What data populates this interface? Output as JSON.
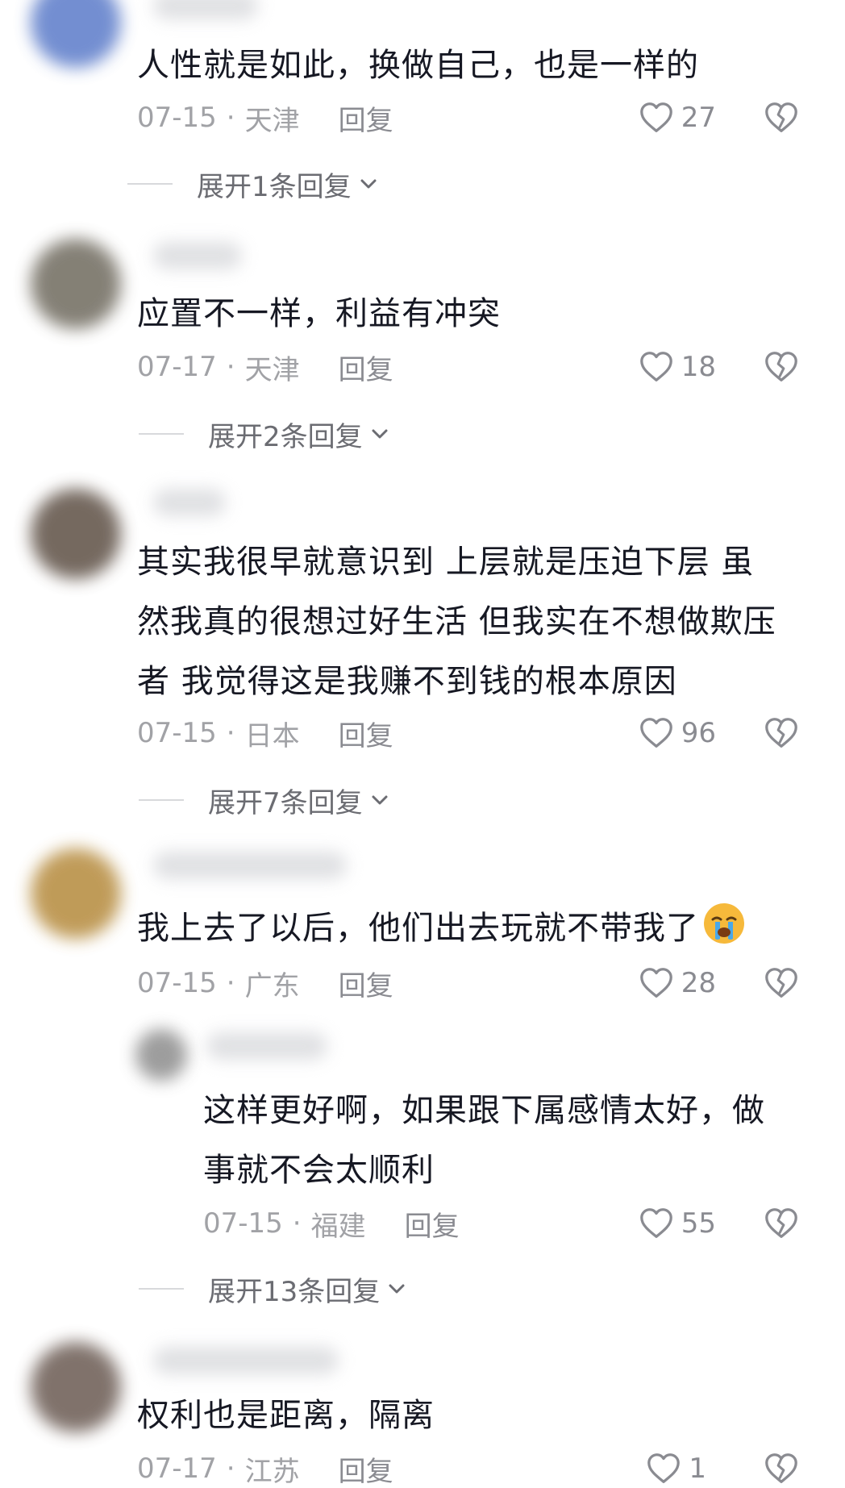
{
  "comments": [
    {
      "text": "人性就是如此，换做自己，也是一样的",
      "date": "07-15",
      "location": "天津",
      "reply_label": "回复",
      "likes": "27",
      "expand_label": "展开1条回复"
    },
    {
      "text": "应置不一样，利益有冲突",
      "date": "07-17",
      "location": "天津",
      "reply_label": "回复",
      "likes": "18",
      "expand_label": "展开2条回复"
    },
    {
      "text_lines": [
        "其实我很早就意识到 上层就是压迫下层 虽",
        "然我真的很想过好生活 但我实在不想做欺压",
        "者 我觉得这是我赚不到钱的根本原因"
      ],
      "date": "07-15",
      "location": "日本",
      "reply_label": "回复",
      "likes": "96",
      "expand_label": "展开7条回复"
    },
    {
      "text": "我上去了以后，他们出去玩就不带我了",
      "emoji": "crying-face",
      "date": "07-15",
      "location": "广东",
      "reply_label": "回复",
      "likes": "28",
      "reply": {
        "text_lines": [
          "这样更好啊，如果跟下属感情太好，做",
          "事就不会太顺利"
        ],
        "date": "07-15",
        "location": "福建",
        "reply_label": "回复",
        "likes": "55"
      },
      "expand_label": "展开13条回复"
    },
    {
      "text": "权利也是距离，隔离",
      "date": "07-17",
      "location": "江苏",
      "reply_label": "回复",
      "likes": "1"
    }
  ],
  "meta_separator": "·",
  "colors": {
    "text": "#161823",
    "meta": "#a1a2a6",
    "emoji": "#f6b93b"
  },
  "icons": [
    "heart-outline-icon",
    "broken-heart-icon",
    "chevron-down-icon",
    "crying-face-emoji-icon"
  ]
}
